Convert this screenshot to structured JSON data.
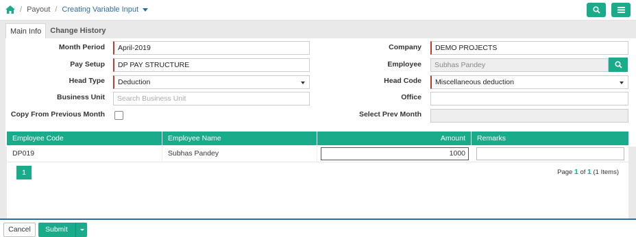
{
  "breadcrumb": {
    "home_icon": "home-icon",
    "items": [
      "Payout",
      "Creating Variable Input"
    ]
  },
  "toolbar": {
    "search_icon": "search-icon",
    "menu_icon": "hamburger-menu-icon"
  },
  "tabs": [
    {
      "label": "Main Info",
      "active": true
    },
    {
      "label": "Change History",
      "active": false
    }
  ],
  "form": {
    "month_period": {
      "label": "Month Period",
      "value": "April-2019"
    },
    "pay_setup": {
      "label": "Pay Setup",
      "value": "DP PAY STRUCTURE"
    },
    "head_type": {
      "label": "Head Type",
      "value": "Deduction"
    },
    "business_unit": {
      "label": "Business Unit",
      "placeholder": "Search Business Unit"
    },
    "copy_prev": {
      "label": "Copy From Previous Month",
      "checked": false
    },
    "company": {
      "label": "Company",
      "value": "DEMO PROJECTS"
    },
    "employee": {
      "label": "Employee",
      "value": "Subhas Pandey"
    },
    "head_code": {
      "label": "Head Code",
      "value": "Miscellaneous deduction"
    },
    "office": {
      "label": "Office",
      "value": ""
    },
    "select_prev_month": {
      "label": "Select Prev Month",
      "value": ""
    }
  },
  "grid": {
    "columns": [
      "Employee Code",
      "Employee Name",
      "Amount",
      "Remarks"
    ],
    "rows": [
      {
        "code": "DP019",
        "name": "Subhas Pandey",
        "amount": "1000",
        "remarks": ""
      }
    ],
    "page_button": "1",
    "page_text": {
      "page": "Page",
      "current": "1",
      "of": "of",
      "total": "1",
      "items": "(1 Items)"
    }
  },
  "footer": {
    "cancel": "Cancel",
    "submit": "Submit"
  },
  "colors": {
    "accent": "#1aab8a",
    "link": "#2e6da4",
    "required": "#c0392b"
  }
}
